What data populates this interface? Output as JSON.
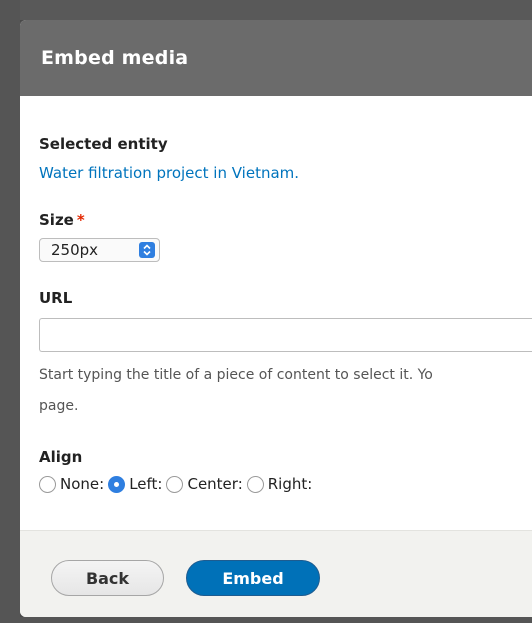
{
  "dialog": {
    "title": "Embed media"
  },
  "form": {
    "selected_entity_label": "Selected entity",
    "selected_entity_link": "Water filtration project in Vietnam.",
    "size_label": "Size",
    "size_required_mark": "*",
    "size_value": "250px",
    "url_label": "URL",
    "url_value": "",
    "url_help_line1": "Start typing the title of a piece of content to select it. Yo",
    "url_help_line2": "page.",
    "align_label": "Align",
    "align_options": [
      {
        "label": "None:",
        "checked": false
      },
      {
        "label": "Left:",
        "checked": true
      },
      {
        "label": "Center:",
        "checked": false
      },
      {
        "label": "Right:",
        "checked": false
      }
    ]
  },
  "footer": {
    "back_label": "Back",
    "embed_label": "Embed"
  },
  "colors": {
    "link": "#0074bd",
    "primary_button": "#0071b8",
    "required": "#e32700",
    "titlebar": "#6b6b6b"
  }
}
